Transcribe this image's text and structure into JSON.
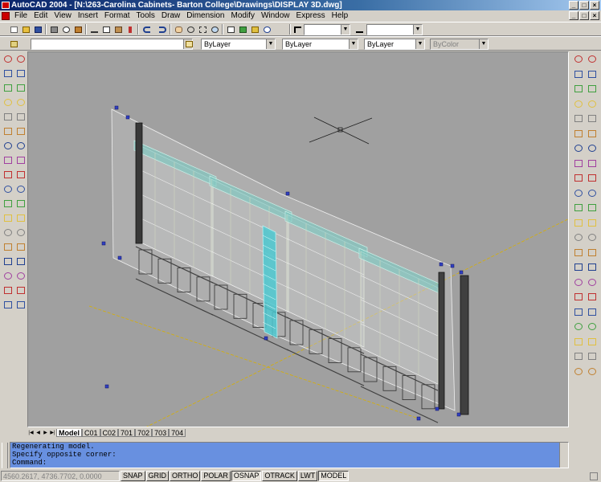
{
  "window": {
    "title": "AutoCAD 2004 - [N:\\263-Carolina Cabinets- Barton College\\Drawings\\DISPLAY 3D.dwg]",
    "minimize": "_",
    "maximize": "□",
    "close": "×"
  },
  "menu": [
    "File",
    "Edit",
    "View",
    "Insert",
    "Format",
    "Tools",
    "Draw",
    "Dimension",
    "Modify",
    "Window",
    "Express",
    "Help"
  ],
  "toolbar": {
    "layer_value": "",
    "text_style_value": "",
    "dim_style_value": "",
    "color_value": "ByLayer",
    "linetype_value": "ByLayer",
    "lineweight_value": "ByLayer",
    "plotstyle_value": "ByColor"
  },
  "layout_tabs": {
    "nav": [
      "|◀",
      "◀",
      "▶",
      "▶|"
    ],
    "tabs": [
      "Model",
      "C01",
      "C02",
      "701",
      "702",
      "703",
      "704"
    ],
    "active": "Model"
  },
  "command_window": {
    "lines": [
      "Regenerating model.",
      "Specify opposite corner:",
      "Command:"
    ]
  },
  "status_bar": {
    "coordinates": "4560.2617, 4736.7702, 0.0000",
    "toggles": [
      "SNAP",
      "GRID",
      "ORTHO",
      "POLAR",
      "OSNAP",
      "OTRACK",
      "LWT",
      "MODEL"
    ],
    "active_toggles": [
      "OSNAP",
      "MODEL"
    ]
  },
  "colors": {
    "title_start": "#0a246a",
    "canvas_bg": "#a0a0a0",
    "command_bg": "#6890e0",
    "glass_accent": "#4cc8d0"
  },
  "icons": {
    "left_toolbar_draw": [
      "line-icon",
      "construction-line-icon",
      "polyline-icon",
      "polygon-icon",
      "rectangle-icon",
      "arc-icon",
      "circle-icon",
      "revcloud-icon",
      "spline-icon",
      "ellipse-icon",
      "ellipse-arc-icon",
      "insert-block-icon",
      "make-block-icon",
      "point-icon",
      "hatch-icon",
      "region-icon",
      "table-icon",
      "mtext-icon"
    ],
    "right_toolbar_modify": [
      "erase-icon",
      "copy-icon",
      "mirror-icon",
      "offset-icon",
      "array-icon",
      "move-icon",
      "rotate-icon",
      "scale-icon",
      "stretch-icon",
      "trim-icon",
      "extend-icon",
      "break-point-icon",
      "break-icon",
      "chamfer-icon",
      "fillet-icon",
      "explode-icon"
    ]
  }
}
